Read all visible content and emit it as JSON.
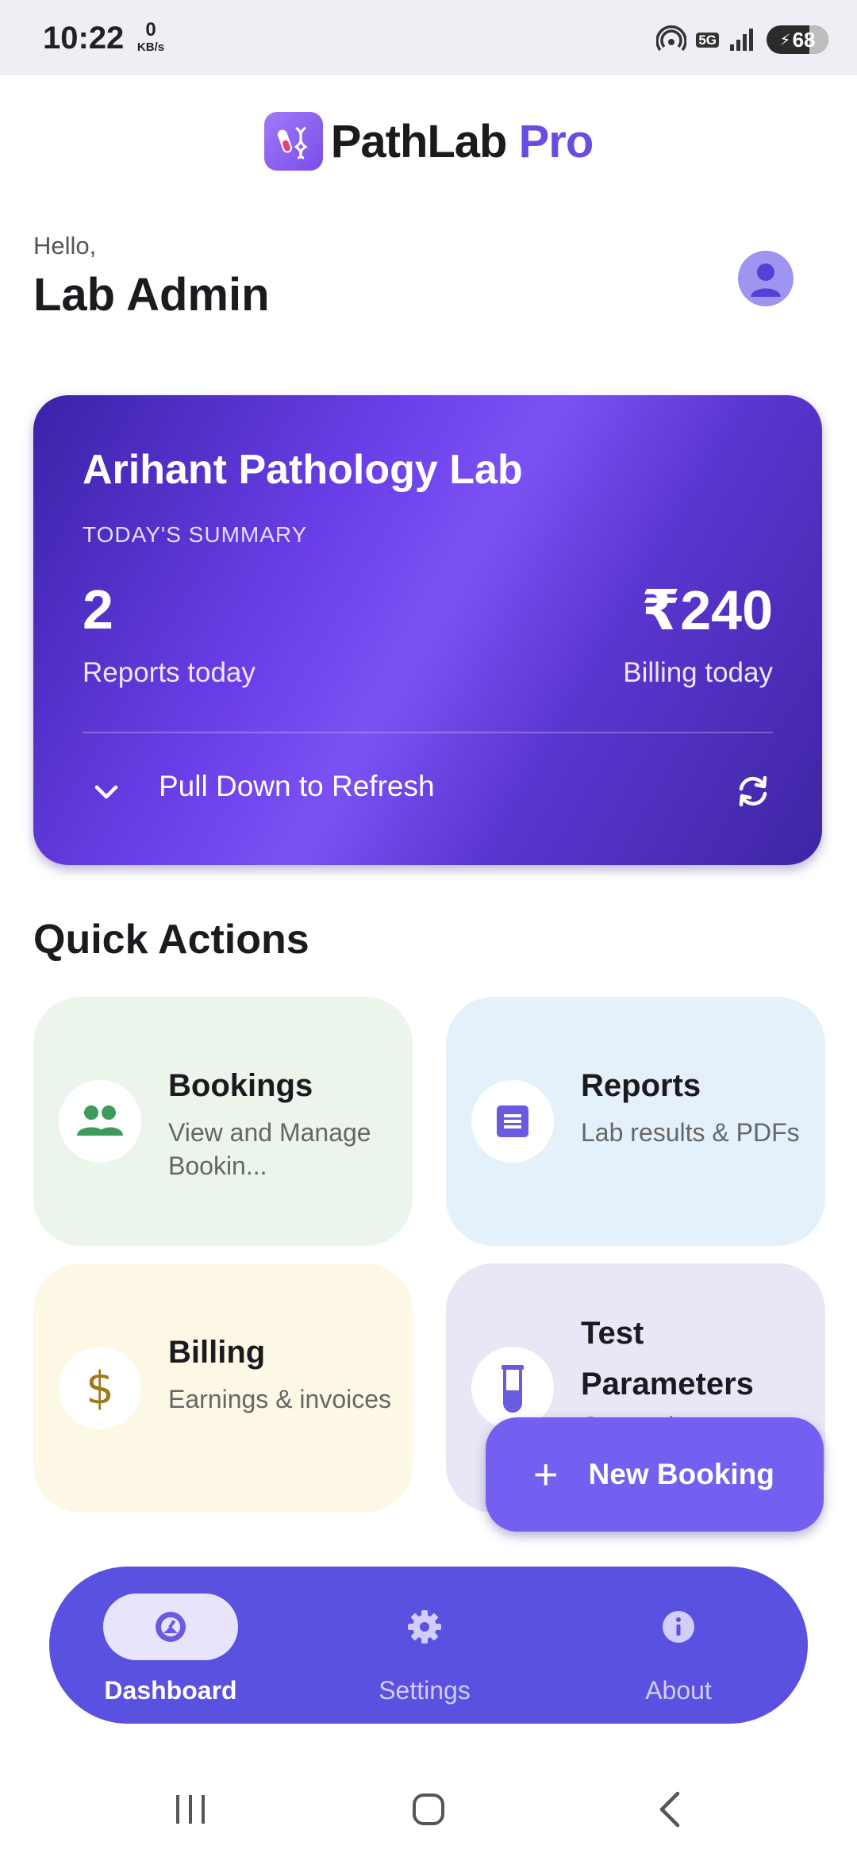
{
  "status_bar": {
    "time": "10:22",
    "speed_value": "0",
    "speed_unit": "KB/s",
    "network": "5G",
    "battery": "68"
  },
  "header": {
    "brand_main": "PathLab",
    "brand_accent": "Pro"
  },
  "greeting": {
    "hello": "Hello,",
    "name": "Lab Admin"
  },
  "summary": {
    "lab_name": "Arihant Pathology Lab",
    "label": "TODAY'S SUMMARY",
    "reports_count": "2",
    "reports_label": "Reports today",
    "billing_amount": "₹240",
    "billing_label": "Billing today",
    "refresh_text": "Pull Down to Refresh"
  },
  "quick_actions": {
    "title": "Quick Actions",
    "bookings": {
      "title": "Bookings",
      "subtitle": "View and Manage Bookin..."
    },
    "reports": {
      "title": "Reports",
      "subtitle": "Lab results & PDFs"
    },
    "billing": {
      "title": "Billing",
      "subtitle": "Earnings & invoices"
    },
    "test_params": {
      "title": "Test Parameters",
      "subtitle": "Customize test"
    }
  },
  "fab": {
    "label": "New Booking"
  },
  "bottom_nav": {
    "dashboard": "Dashboard",
    "settings": "Settings",
    "about": "About"
  },
  "colors": {
    "primary": "#5a51e0",
    "accent": "#6a4de0",
    "fab": "#7360f0"
  },
  "icons": [
    "dna-vial-logo",
    "user-icon",
    "chevron-down-icon",
    "refresh-icon",
    "people-icon",
    "document-icon",
    "dollar-icon",
    "test-tube-icon",
    "plus-icon",
    "dashboard-icon",
    "gear-icon",
    "info-icon"
  ]
}
